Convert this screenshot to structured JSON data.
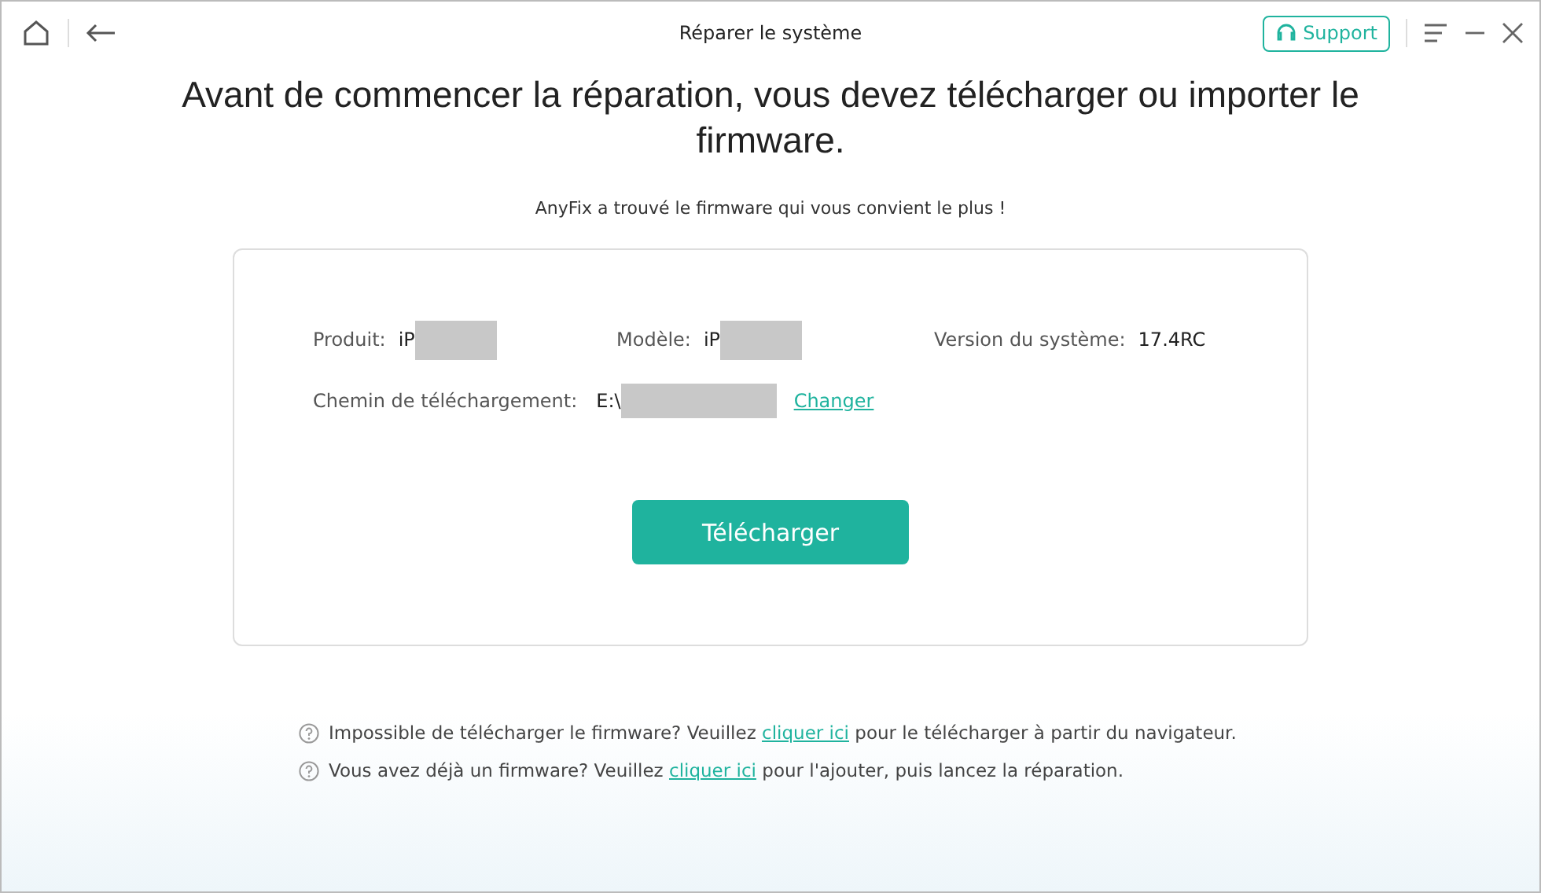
{
  "window": {
    "title": "Réparer le système",
    "support_button": "Support"
  },
  "heading": "Avant de commencer la réparation, vous devez télécharger ou importer le firmware.",
  "subtitle": "AnyFix a trouvé le firmware qui vous convient le plus !",
  "info": {
    "product": {
      "label": "Produit:",
      "value": "iP"
    },
    "model": {
      "label": "Modèle:",
      "value": "iP"
    },
    "version": {
      "label": "Version du système:",
      "value": "17.4RC"
    },
    "path": {
      "label": "Chemin de téléchargement:",
      "value": "E:\\",
      "link": "Changer"
    }
  },
  "download_button": "Télécharger",
  "help": [
    {
      "before": "Impossible de télécharger le firmware? Veuillez ",
      "link": "cliquer ici",
      "after": " pour le télécharger à partir du navigateur."
    },
    {
      "before": "Vous avez déjà un firmware? Veuillez ",
      "link": "cliquer ici",
      "after": " pour l'ajouter, puis lancez la réparation."
    }
  ]
}
